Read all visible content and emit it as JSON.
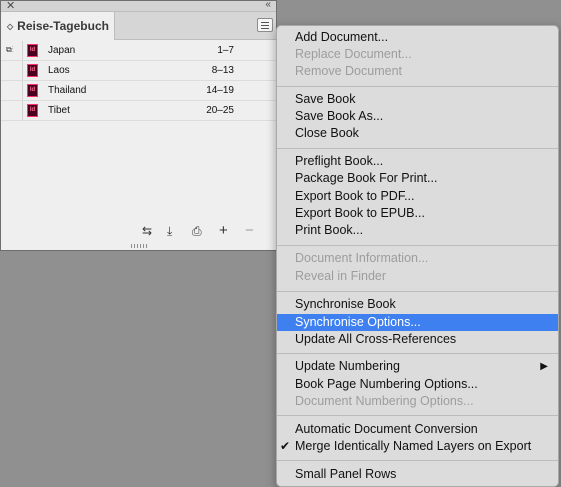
{
  "panel": {
    "title": "Reise-Tagebuch",
    "documents": [
      {
        "name": "Japan",
        "pages": "1–7"
      },
      {
        "name": "Laos",
        "pages": "8–13"
      },
      {
        "name": "Thailand",
        "pages": "14–19"
      },
      {
        "name": "Tibet",
        "pages": "20–25"
      }
    ],
    "icon_label": "Id",
    "toolbar": [
      "sync-pages-icon",
      "save-book-icon",
      "print-book-icon",
      "add-document-icon",
      "remove-document-icon"
    ]
  },
  "menu": {
    "items": [
      {
        "label": "Add Document...",
        "disabled": false
      },
      {
        "label": "Replace Document...",
        "disabled": true
      },
      {
        "label": "Remove Document",
        "disabled": true
      },
      {
        "label": "Save Book",
        "disabled": false
      },
      {
        "label": "Save Book As...",
        "disabled": false
      },
      {
        "label": "Close Book",
        "disabled": false
      },
      {
        "label": "Preflight Book...",
        "disabled": false
      },
      {
        "label": "Package Book For Print...",
        "disabled": false
      },
      {
        "label": "Export Book to PDF...",
        "disabled": false
      },
      {
        "label": "Export Book to EPUB...",
        "disabled": false
      },
      {
        "label": "Print Book...",
        "disabled": false
      },
      {
        "label": "Document Information...",
        "disabled": true
      },
      {
        "label": "Reveal in Finder",
        "disabled": true
      },
      {
        "label": "Synchronise Book",
        "disabled": false
      },
      {
        "label": "Synchronise Options...",
        "disabled": false,
        "highlighted": true
      },
      {
        "label": "Update All Cross-References",
        "disabled": false
      },
      {
        "label": "Update Numbering",
        "disabled": false,
        "submenu": true
      },
      {
        "label": "Book Page Numbering Options...",
        "disabled": false
      },
      {
        "label": "Document Numbering Options...",
        "disabled": true
      },
      {
        "label": "Automatic Document Conversion",
        "disabled": false
      },
      {
        "label": "Merge Identically Named Layers on Export",
        "disabled": false,
        "checked": true
      },
      {
        "label": "Small Panel Rows",
        "disabled": false
      }
    ]
  },
  "colors": {
    "highlight": "#3f80f0",
    "menu_bg": "#dcdcdc",
    "indesign_icon": "#49021f"
  }
}
